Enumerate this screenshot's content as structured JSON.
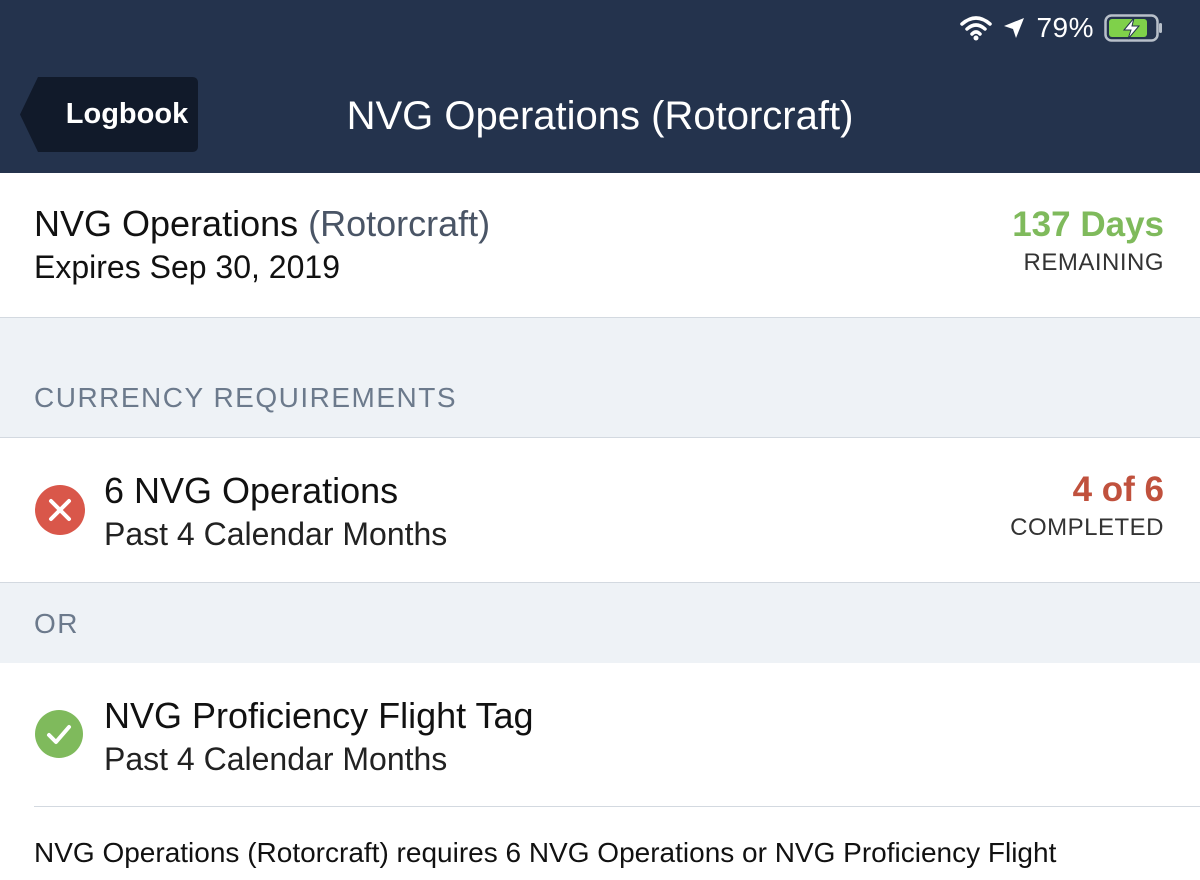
{
  "status_bar": {
    "battery_percent": "79%",
    "icons": [
      "wifi-icon",
      "location-arrow-icon",
      "battery-charging-icon"
    ]
  },
  "nav": {
    "back_label": "Logbook",
    "title": "NVG Operations (Rotorcraft)"
  },
  "summary": {
    "name": "NVG Operations",
    "category": "(Rotorcraft)",
    "expires": "Expires Sep 30, 2019",
    "days": "137 Days",
    "days_label": "REMAINING"
  },
  "sections": {
    "currency_header": "CURRENCY REQUIREMENTS",
    "or_header": "OR"
  },
  "requirements": [
    {
      "title": "6 NVG Operations",
      "subtitle": "Past 4 Calendar Months",
      "status": "failed",
      "count": "4 of 6",
      "count_label": "COMPLETED"
    },
    {
      "title": "NVG Proficiency Flight Tag",
      "subtitle": "Past 4 Calendar Months",
      "status": "passed"
    }
  ],
  "description": "NVG Operations (Rotorcraft) requires 6 NVG Operations or NVG Proficiency Flight",
  "colors": {
    "navbar": "#24334d",
    "remaining_green": "#7fba5c",
    "failed_red": "#d9574a",
    "count_red": "#c0513d",
    "passed_green": "#7fba5c",
    "section_bg": "#eef2f6"
  }
}
